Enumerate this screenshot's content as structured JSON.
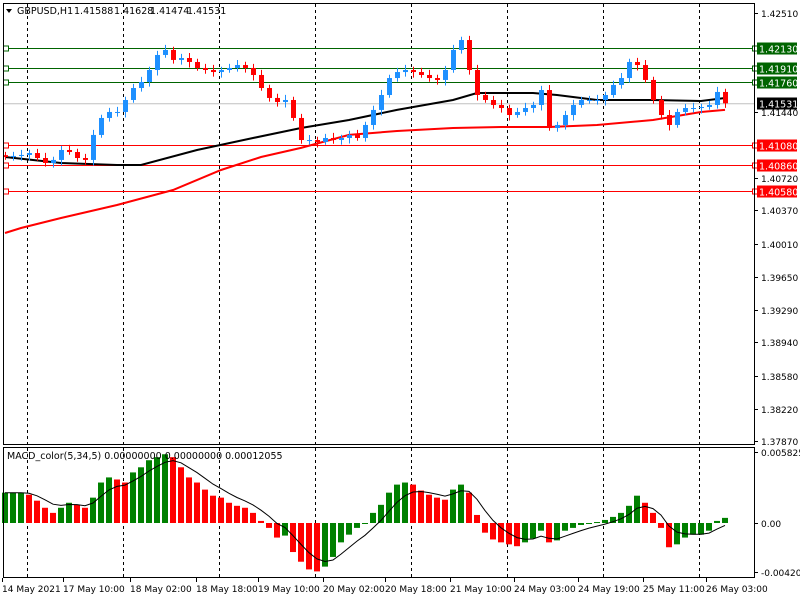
{
  "chart_data": [
    {
      "type": "candlestick",
      "title": "GBPUSD,H1",
      "ohlc_header": [
        "1.41588",
        "1.41628",
        "1.41474",
        "1.41531"
      ],
      "ylim": [
        1.3787,
        1.4251
      ],
      "y_ticks": [
        "1.42510",
        "1.41440",
        "1.40720",
        "1.40370",
        "1.40010",
        "1.39650",
        "1.39290",
        "1.38940",
        "1.38580",
        "1.38220",
        "1.37870"
      ],
      "x_tick_labels": [
        "14 May 2021",
        "17 May 10:00",
        "18 May 02:00",
        "18 May 18:00",
        "19 May 10:00",
        "20 May 02:00",
        "20 May 18:00",
        "21 May 10:00",
        "24 May 03:00",
        "24 May 19:00",
        "25 May 11:00",
        "26 May 03:00"
      ],
      "grid": "vertical-dashed",
      "close": [
        1.40949,
        1.4096,
        1.40971,
        1.40992,
        1.40938,
        1.40884,
        1.40917,
        1.41025,
        1.41003,
        1.40938,
        1.40917,
        1.41188,
        1.41372,
        1.41437,
        1.41437,
        1.41567,
        1.41697,
        1.41762,
        1.41892,
        1.42055,
        1.42109,
        1.42001,
        1.42022,
        1.41979,
        1.41914,
        1.41892,
        1.4187,
        1.41892,
        1.41914,
        1.41946,
        1.41914,
        1.41838,
        1.41697,
        1.41589,
        1.41545,
        1.41567,
        1.41372,
        1.41133,
        1.41133,
        1.41112,
        1.41155,
        1.41133,
        1.41155,
        1.41188,
        1.41155,
        1.41296,
        1.41459,
        1.41621,
        1.41805,
        1.4187,
        1.41892,
        1.4187,
        1.41838,
        1.41805,
        1.41784,
        1.41892,
        1.42109,
        1.42217,
        1.41892,
        1.41621,
        1.41567,
        1.41513,
        1.4148,
        1.41404,
        1.41437,
        1.4148,
        1.41513,
        1.41675,
        1.41263,
        1.41296,
        1.41404,
        1.41513,
        1.41567,
        1.41567,
        1.41567,
        1.41621,
        1.4173,
        1.41805,
        1.41979,
        1.41946,
        1.41784,
        1.41567,
        1.41404,
        1.41296,
        1.41437,
        1.4148,
        1.4148,
        1.41491,
        1.41513,
        1.41654,
        1.41531
      ],
      "ma_slow_black": [
        [
          0,
          1.40949
        ],
        [
          7,
          1.40884
        ],
        [
          14,
          1.40862
        ],
        [
          17,
          1.40862
        ],
        [
          24,
          1.41025
        ],
        [
          31,
          1.41155
        ],
        [
          37,
          1.41263
        ],
        [
          43,
          1.4135
        ],
        [
          49,
          1.41459
        ],
        [
          56,
          1.41567
        ],
        [
          59,
          1.41643
        ],
        [
          66,
          1.41643
        ],
        [
          69,
          1.41621
        ],
        [
          74,
          1.41567
        ],
        [
          81,
          1.41567
        ],
        [
          87,
          1.41556
        ],
        [
          90,
          1.41589
        ]
      ],
      "ma_red": [
        [
          0,
          1.40125
        ],
        [
          2,
          1.40179
        ],
        [
          7,
          1.40288
        ],
        [
          14,
          1.40429
        ],
        [
          21,
          1.40591
        ],
        [
          27,
          1.40808
        ],
        [
          32,
          1.40949
        ],
        [
          37,
          1.41047
        ],
        [
          43,
          1.41188
        ],
        [
          49,
          1.41231
        ],
        [
          56,
          1.41263
        ],
        [
          62,
          1.41274
        ],
        [
          68,
          1.41274
        ],
        [
          74,
          1.41296
        ],
        [
          81,
          1.4135
        ],
        [
          87,
          1.41437
        ],
        [
          90,
          1.41459
        ]
      ],
      "levels": [
        {
          "price": 1.4213,
          "label": "1.42130",
          "color": "#006400"
        },
        {
          "price": 1.4191,
          "label": "1.41910",
          "color": "#006400"
        },
        {
          "price": 1.4176,
          "label": "1.41760",
          "color": "#006400"
        },
        {
          "price": 1.4108,
          "label": "1.41080",
          "color": "#ff0000"
        },
        {
          "price": 1.4086,
          "label": "1.40860",
          "color": "#ff0000"
        },
        {
          "price": 1.4058,
          "label": "1.40580",
          "color": "#ff0000"
        }
      ],
      "current_price": {
        "price": 1.41531,
        "label": "1.41531"
      },
      "colors": {
        "bull": "#1e90ff",
        "bear": "#ff0000",
        "ma_slow": "#000000",
        "ma_fast": "#ff0000",
        "bid_line": "#c0c0c0"
      }
    },
    {
      "type": "bar",
      "title": "MACD_color(5,34,5) 0.00000000 0.00000000 0.00012055",
      "ylim": [
        -0.0042016,
        0.0058252
      ],
      "y_ticks": [
        "0.0058252",
        "0.00",
        "-0.0042016"
      ],
      "histogram": [
        0.00249,
        0.00249,
        0.00249,
        0.00232,
        0.00183,
        0.00125,
        0.00083,
        0.00125,
        0.00166,
        0.00149,
        0.00125,
        0.00208,
        0.00332,
        0.00374,
        0.00357,
        0.00332,
        0.00415,
        0.00457,
        0.00515,
        0.0054,
        0.00564,
        0.0054,
        0.00457,
        0.00374,
        0.00332,
        0.00274,
        0.00224,
        0.00208,
        0.00166,
        0.00141,
        0.00125,
        0.00083,
        0.00017,
        -0.00042,
        -0.00125,
        -0.00108,
        -0.00249,
        -0.00332,
        -0.00398,
        -0.00415,
        -0.00374,
        -0.00291,
        -0.00166,
        -0.001,
        -0.00042,
        -8e-05,
        0.00083,
        0.00149,
        0.00249,
        0.00315,
        0.00332,
        0.00315,
        0.00266,
        0.00232,
        0.00208,
        0.00191,
        0.00274,
        0.00315,
        0.00249,
        0.00066,
        -0.00083,
        -0.00141,
        -0.00166,
        -0.00183,
        -0.00199,
        -0.00166,
        -0.00133,
        -0.00066,
        -0.00166,
        -0.00149,
        -0.00066,
        -0.00042,
        -0.00017,
        0,
        8e-05,
        0.00025,
        0.0005,
        0.00083,
        0.00141,
        0.00224,
        0.00166,
        0.00083,
        -0.00042,
        -0.00208,
        -0.00183,
        -0.00125,
        -0.001,
        -0.001,
        -0.00066,
        0.00017,
        0.00042
      ],
      "colors": {
        "up": "#008000",
        "down": "#ff0000",
        "signal": "#000000"
      }
    }
  ]
}
